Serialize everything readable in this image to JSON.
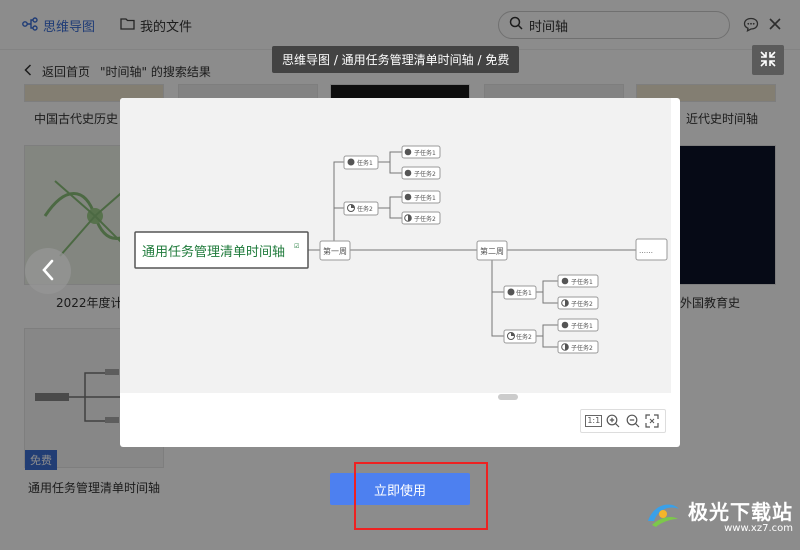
{
  "topbar": {
    "tab_mindmap": "思维导图",
    "tab_files": "我的文件",
    "search_value": "时间轴"
  },
  "breadcrumb": {
    "back_label": "返回首页",
    "results_label": "\"时间轴\" 的搜索结果"
  },
  "cards": {
    "row1_left": "中国古代史历史",
    "row1_right": "近代史时间轴",
    "row2_left": "2022年度计",
    "row2_right": "外国教育史",
    "row3_left": "通用任务管理清单时间轴",
    "free_badge": "免费"
  },
  "modal": {
    "breadcrumb": "思维导图  / 通用任务管理清单时间轴 /  免费",
    "use_button": "立即使用"
  },
  "mindmap": {
    "root": "通用任务管理清单时间轴",
    "week1": "第一周",
    "week2": "第二周",
    "ellipsis": "……",
    "task1": "任务1",
    "task2": "任务2",
    "subtask1": "子任务1",
    "subtask2": "子任务2"
  },
  "zoom": {
    "reset_label": "1:1"
  },
  "watermark": {
    "brand": "极光下载站",
    "url": "www.xz7.com"
  },
  "colors": {
    "accent": "#4d80f0",
    "tab_active": "#3a6ed8",
    "root_text": "#1e7a3a",
    "highlight": "#e22222"
  }
}
